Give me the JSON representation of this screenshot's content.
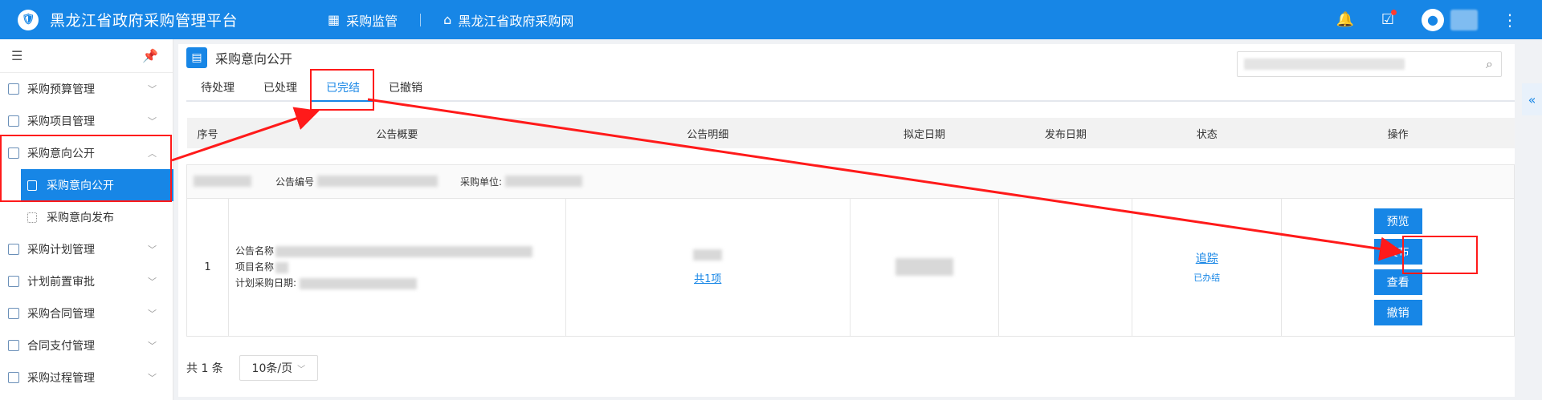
{
  "topbar": {
    "logo_glyph": "🛡",
    "app_title": "黑龙江省政府采购管理平台",
    "nav_monitor": "采购监管",
    "nav_portal": "黑龙江省政府采购网",
    "icons": [
      "bell-icon",
      "clipboard-icon",
      "user-icon",
      "more-icon"
    ]
  },
  "sidebar": {
    "items": [
      {
        "label": "采购预算管理"
      },
      {
        "label": "采购项目管理"
      },
      {
        "label": "采购意向公开"
      },
      {
        "label": "采购意向公开"
      },
      {
        "label": "采购意向发布"
      },
      {
        "label": "采购计划管理"
      },
      {
        "label": "计划前置审批"
      },
      {
        "label": "采购合同管理"
      },
      {
        "label": "合同支付管理"
      },
      {
        "label": "采购过程管理"
      }
    ]
  },
  "page": {
    "title": "采购意向公开",
    "tabs": [
      "待处理",
      "已处理",
      "已完结",
      "已撤销"
    ],
    "active_tab": "已完结"
  },
  "table": {
    "headers": [
      "序号",
      "公告概要",
      "公告明细",
      "拟定日期",
      "发布日期",
      "状态",
      "操作"
    ],
    "group": {
      "notice_no_label": "公告编号",
      "unit_label": "采购单位:"
    },
    "row": {
      "index": "1",
      "summary_name_label": "公告名称",
      "summary_project_label": "项目名称",
      "summary_date_label": "计划采购日期:",
      "detail_link": "共1项",
      "status_link": "追踪",
      "status_text": "已办结",
      "actions": [
        "预览",
        "发布",
        "查看",
        "撤销"
      ]
    }
  },
  "pager": {
    "total": "共 1 条",
    "page_size": "10条/页"
  },
  "colors": {
    "primary": "#1786e6",
    "annotation": "#ff1a1a"
  }
}
